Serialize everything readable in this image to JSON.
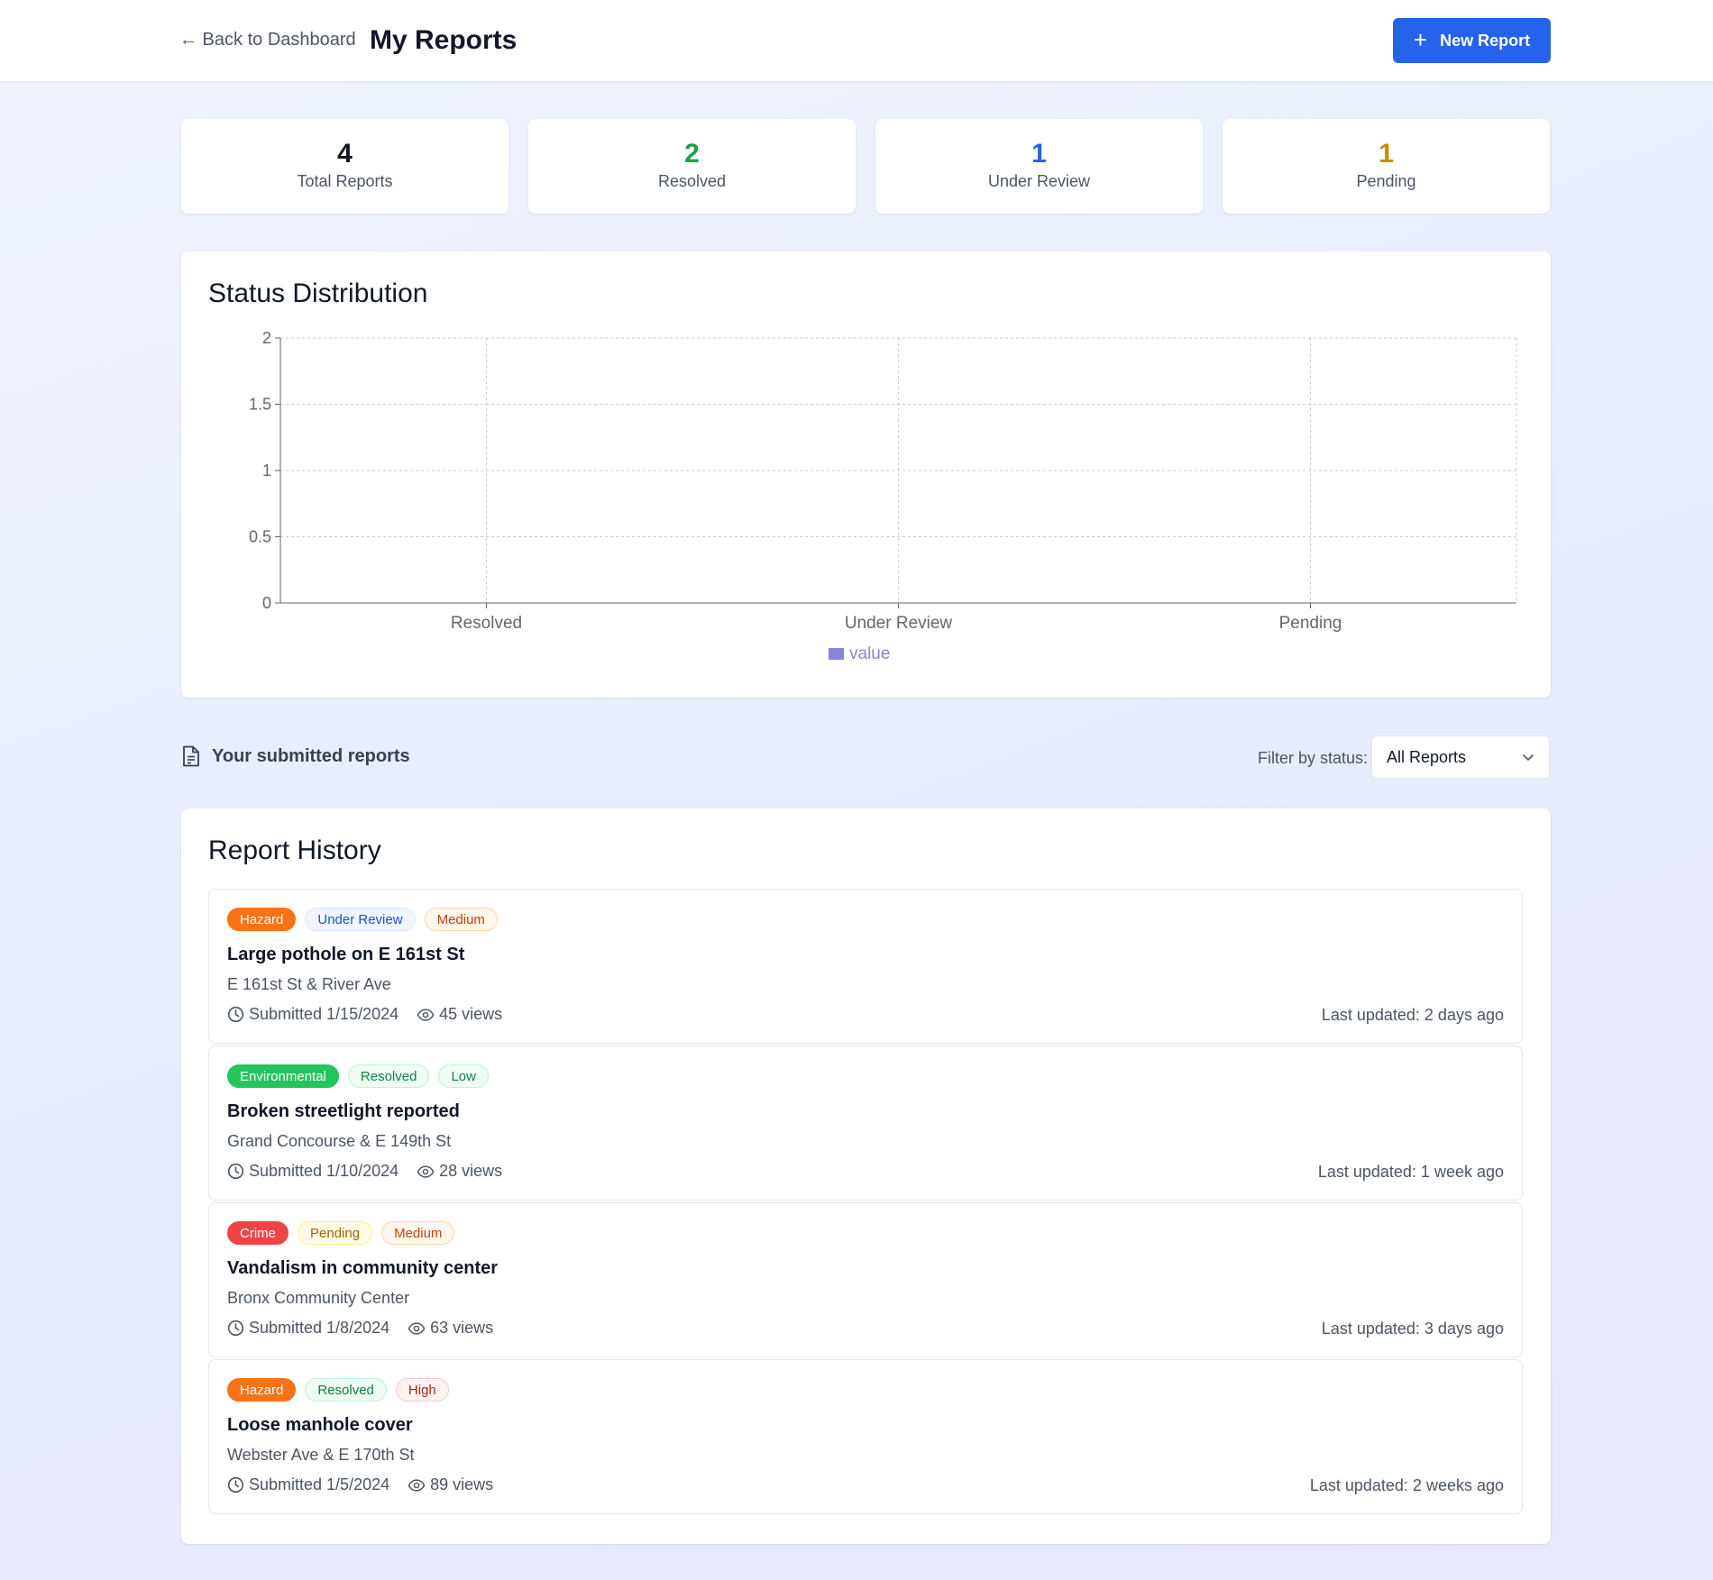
{
  "header": {
    "back_label": "← Back to Dashboard",
    "title": "My Reports",
    "new_report_label": "New Report",
    "new_report_icon": "plus-icon",
    "accent_color": "#2563eb"
  },
  "stats": [
    {
      "value": "4",
      "label": "Total Reports",
      "color": "#111827"
    },
    {
      "value": "2",
      "label": "Resolved",
      "color": "#16a34a"
    },
    {
      "value": "1",
      "label": "Under Review",
      "color": "#2563eb"
    },
    {
      "value": "1",
      "label": "Pending",
      "color": "#ca8a04"
    }
  ],
  "chart_card": {
    "title": "Status Distribution"
  },
  "chart_data": {
    "type": "bar",
    "title": "Status Distribution",
    "categories": [
      "Resolved",
      "Under Review",
      "Pending"
    ],
    "series": [
      {
        "name": "value",
        "values": [
          0,
          0,
          0
        ],
        "color": "#8884d8"
      }
    ],
    "yticks": [
      "0",
      "0.5",
      "1",
      "1.5",
      "2"
    ],
    "ylim": [
      0,
      2
    ],
    "grid": true,
    "legend": "bottom"
  },
  "filters": {
    "section_label": "Your submitted reports",
    "section_icon": "document-icon",
    "filter_label": "Filter by status:",
    "selected": "All Reports"
  },
  "history": {
    "title": "Report History",
    "reports": [
      {
        "tags": [
          {
            "text": "Hazard",
            "bg": "#f97316",
            "fg": "#ffffff",
            "border": "#f97316"
          },
          {
            "text": "Under Review",
            "bg": "#eff6ff",
            "fg": "#1d4ed8",
            "border": "#dbeafe"
          },
          {
            "text": "Medium",
            "bg": "#fff7ed",
            "fg": "#c2410c",
            "border": "#fed7aa"
          }
        ],
        "title": "Large pothole on E 161st St",
        "location": "E 161st St & River Ave",
        "submitted": "Submitted 1/15/2024",
        "views": "45 views",
        "updated": "Last updated: 2 days ago"
      },
      {
        "tags": [
          {
            "text": "Environmental",
            "bg": "#22c55e",
            "fg": "#ffffff",
            "border": "#22c55e"
          },
          {
            "text": "Resolved",
            "bg": "#f0fdf4",
            "fg": "#15803d",
            "border": "#bbf7d0"
          },
          {
            "text": "Low",
            "bg": "#f0fdf4",
            "fg": "#15803d",
            "border": "#bbf7d0"
          }
        ],
        "title": "Broken streetlight reported",
        "location": "Grand Concourse & E 149th St",
        "submitted": "Submitted 1/10/2024",
        "views": "28 views",
        "updated": "Last updated: 1 week ago"
      },
      {
        "tags": [
          {
            "text": "Crime",
            "bg": "#ef4444",
            "fg": "#ffffff",
            "border": "#ef4444"
          },
          {
            "text": "Pending",
            "bg": "#fefce8",
            "fg": "#a16207",
            "border": "#fef08a"
          },
          {
            "text": "Medium",
            "bg": "#fff7ed",
            "fg": "#c2410c",
            "border": "#fed7aa"
          }
        ],
        "title": "Vandalism in community center",
        "location": "Bronx Community Center",
        "submitted": "Submitted 1/8/2024",
        "views": "63 views",
        "updated": "Last updated: 3 days ago"
      },
      {
        "tags": [
          {
            "text": "Hazard",
            "bg": "#f97316",
            "fg": "#ffffff",
            "border": "#f97316"
          },
          {
            "text": "Resolved",
            "bg": "#f0fdf4",
            "fg": "#15803d",
            "border": "#bbf7d0"
          },
          {
            "text": "High",
            "bg": "#fef2f2",
            "fg": "#b91c1c",
            "border": "#fecaca"
          }
        ],
        "title": "Loose manhole cover",
        "location": "Webster Ave & E 170th St",
        "submitted": "Submitted 1/5/2024",
        "views": "89 views",
        "updated": "Last updated: 2 weeks ago"
      }
    ]
  }
}
